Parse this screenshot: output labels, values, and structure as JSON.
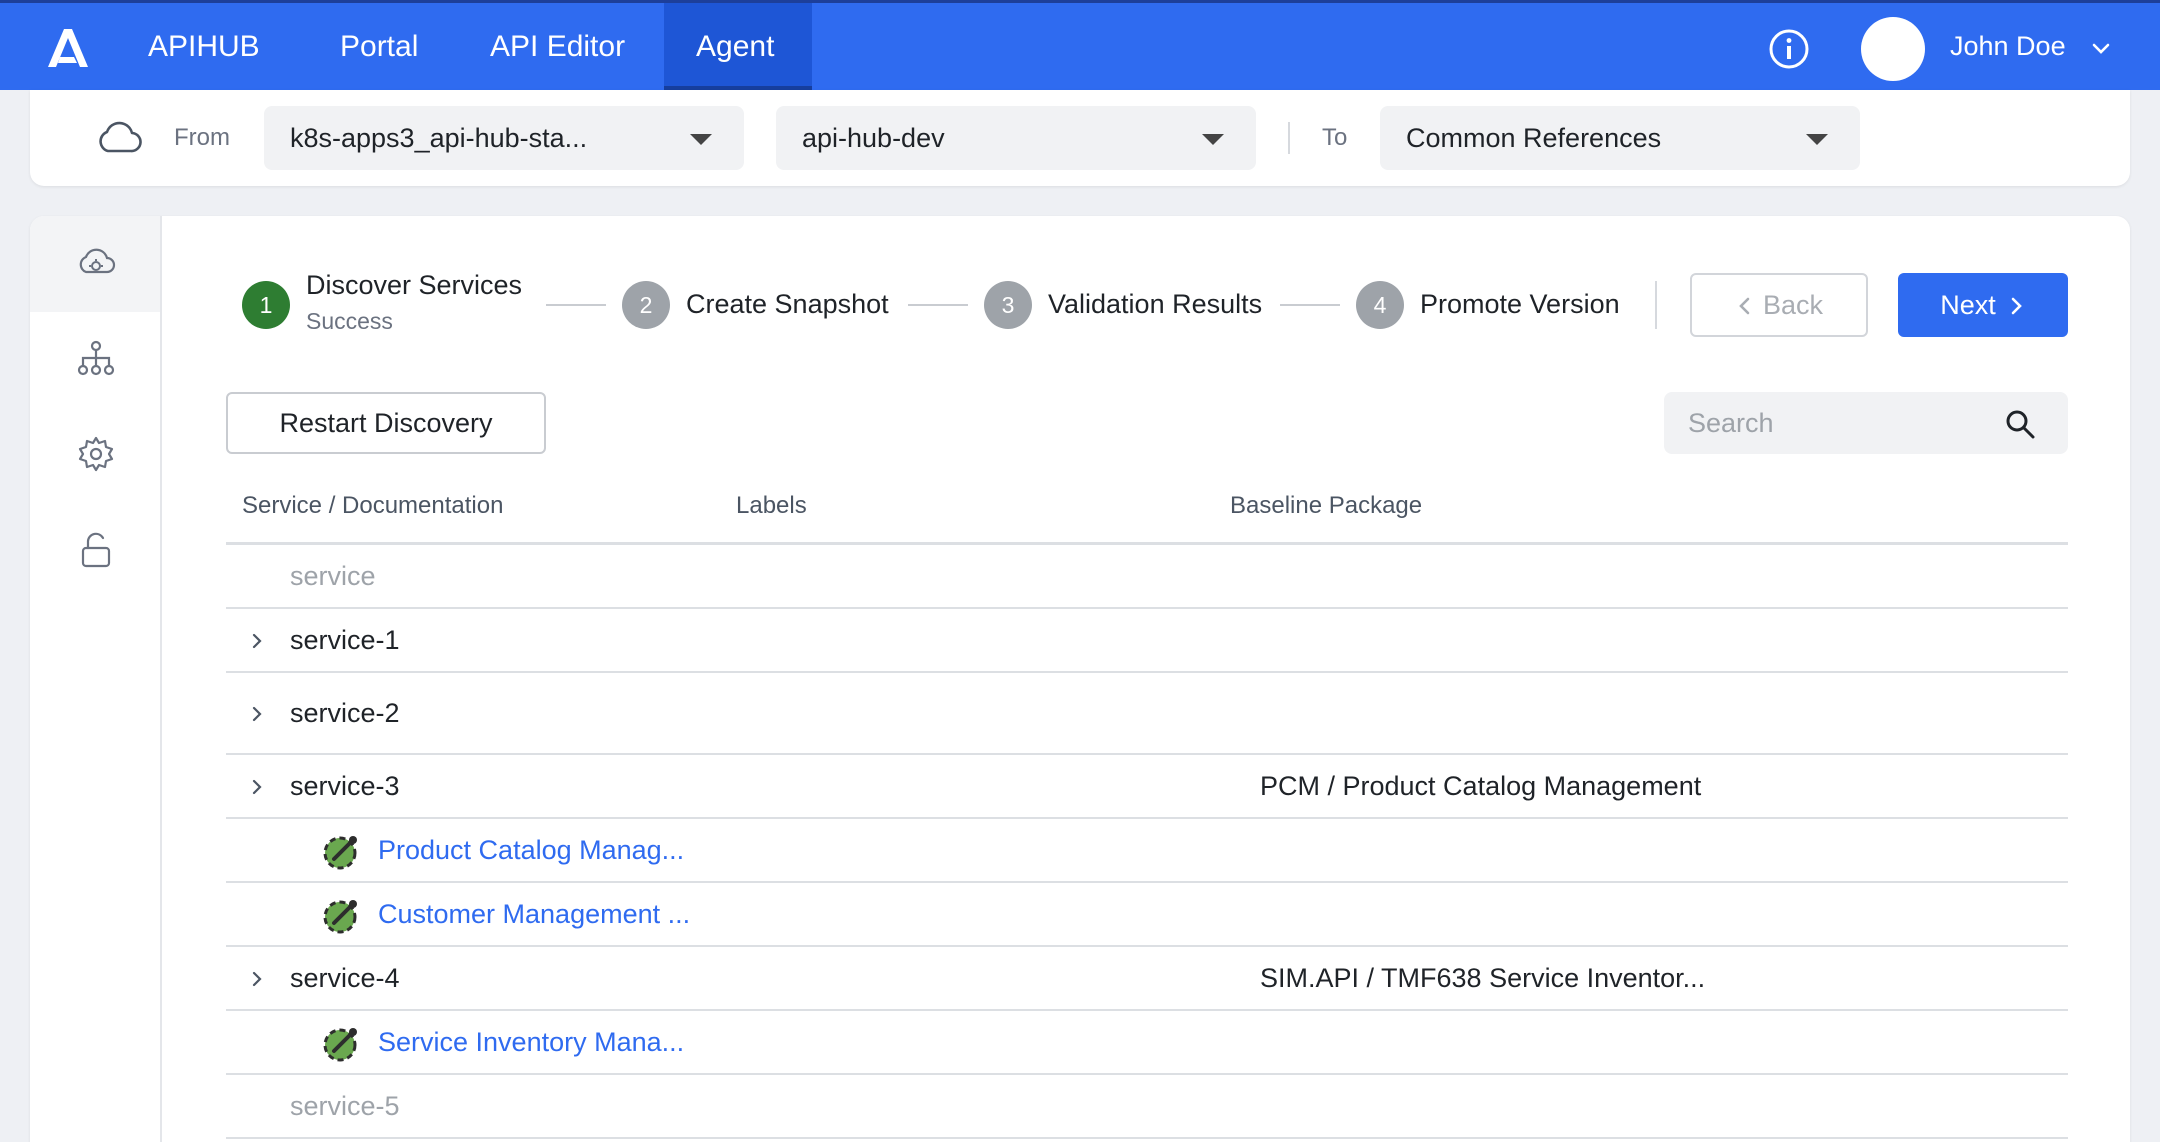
{
  "app": {
    "logo_icon": "apihub-logo-icon",
    "brand": "APIHUB"
  },
  "nav": {
    "items": [
      {
        "label": "Portal"
      },
      {
        "label": "API Editor"
      },
      {
        "label": "Agent",
        "active": true
      }
    ]
  },
  "user": {
    "name": "John Doe"
  },
  "source": {
    "from_label": "From",
    "from_cluster": "k8s-apps3_api-hub-sta...",
    "from_namespace": "api-hub-dev",
    "to_label": "To",
    "to_target": "Common References"
  },
  "sidebar": {
    "items": [
      {
        "icon": "cloud-gear-icon",
        "active": true
      },
      {
        "icon": "hierarchy-icon"
      },
      {
        "icon": "gear-icon"
      },
      {
        "icon": "unlock-icon"
      }
    ]
  },
  "stepper": {
    "steps": [
      {
        "num": "1",
        "label": "Discover Services",
        "status": "Success",
        "done": true
      },
      {
        "num": "2",
        "label": "Create Snapshot"
      },
      {
        "num": "3",
        "label": "Validation Results"
      },
      {
        "num": "4",
        "label": "Promote Version"
      }
    ]
  },
  "buttons": {
    "back": "Back",
    "next": "Next",
    "restart": "Restart Discovery"
  },
  "search": {
    "placeholder": "Search"
  },
  "table": {
    "headers": {
      "service": "Service / Documentation",
      "labels": "Labels",
      "baseline": "Baseline Package"
    },
    "rows": [
      {
        "type": "service",
        "name": "service",
        "muted": true
      },
      {
        "type": "service",
        "name": "service-1",
        "expandable": true
      },
      {
        "type": "service",
        "name": "service-2",
        "expandable": true
      },
      {
        "type": "service",
        "name": "service-3",
        "expandable": true,
        "baseline": "PCM / Product Catalog Management"
      },
      {
        "type": "doc",
        "name": "Product Catalog Manag..."
      },
      {
        "type": "doc",
        "name": "Customer Management ..."
      },
      {
        "type": "service",
        "name": "service-4",
        "expandable": true,
        "baseline": "SIM.API / TMF638 Service Inventor..."
      },
      {
        "type": "doc",
        "name": "Service Inventory Mana..."
      },
      {
        "type": "service",
        "name": "service-5",
        "muted": true
      }
    ]
  },
  "colors": {
    "primary": "#2f6bf0",
    "success": "#2e7d32",
    "link": "#2f6bf0"
  }
}
